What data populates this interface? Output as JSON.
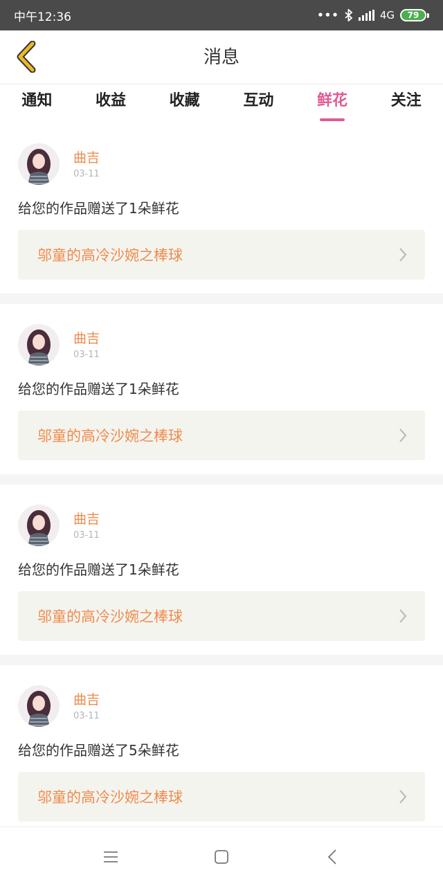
{
  "status_bar": {
    "time": "中午12:36",
    "dots": "•••",
    "network": "4G",
    "battery": "79",
    "icons": [
      "bluetooth-icon",
      "signal-icon",
      "battery-icon"
    ]
  },
  "header": {
    "title": "消息",
    "back_icon": "chevron-left-icon"
  },
  "tabs": [
    {
      "label": "通知",
      "active": false
    },
    {
      "label": "收益",
      "active": false
    },
    {
      "label": "收藏",
      "active": false
    },
    {
      "label": "互动",
      "active": false
    },
    {
      "label": "鲜花",
      "active": true
    },
    {
      "label": "关注",
      "active": false
    }
  ],
  "notifications": [
    {
      "user": "曲吉",
      "date": "03-11",
      "message": "给您的作品赠送了1朵鲜花",
      "work_title": "邬童的高冷沙婉之棒球"
    },
    {
      "user": "曲吉",
      "date": "03-11",
      "message": "给您的作品赠送了1朵鲜花",
      "work_title": "邬童的高冷沙婉之棒球"
    },
    {
      "user": "曲吉",
      "date": "03-11",
      "message": "给您的作品赠送了1朵鲜花",
      "work_title": "邬童的高冷沙婉之棒球"
    },
    {
      "user": "曲吉",
      "date": "03-11",
      "message": "给您的作品赠送了5朵鲜花",
      "work_title": "邬童的高冷沙婉之棒球"
    }
  ],
  "nav_bar": {
    "icons": [
      "menu-icon",
      "home-square-icon",
      "back-triangle-icon"
    ]
  },
  "colors": {
    "accent": "#e05a95",
    "username": "#f08a4b",
    "status_bar": "#4a4a4a",
    "back_arrow": "#e9b928"
  }
}
